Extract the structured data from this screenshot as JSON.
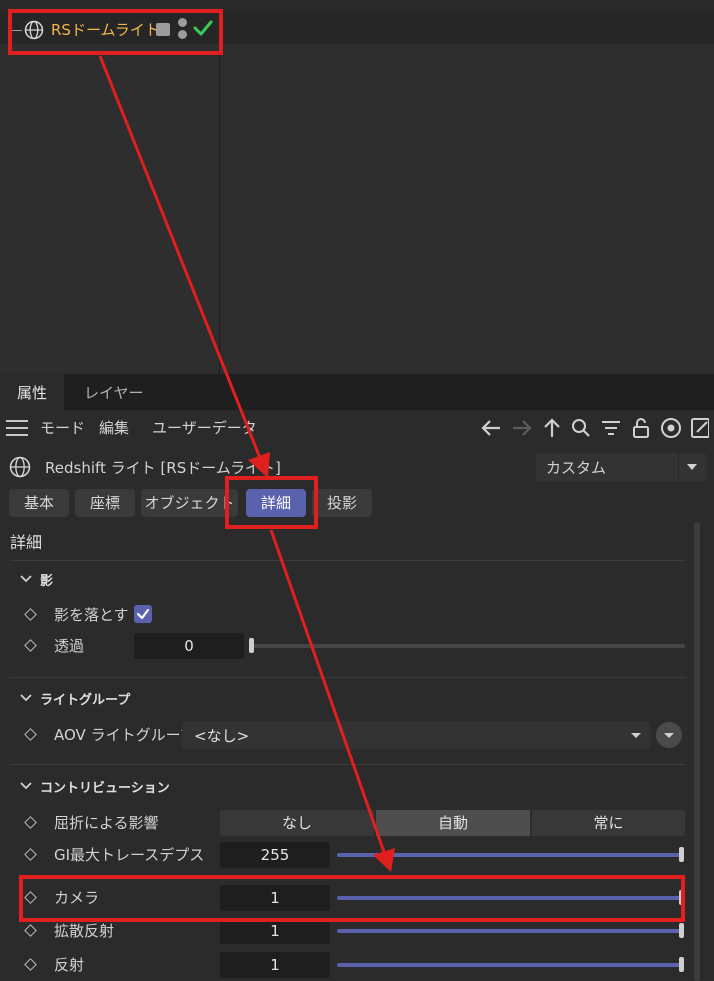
{
  "object_manager": {
    "object_name": "RSドームライト"
  },
  "attribute_manager": {
    "tabs": [
      {
        "label": "属性"
      },
      {
        "label": "レイヤー"
      }
    ],
    "menu": {
      "mode": "モード",
      "edit": "編集",
      "user_data": "ユーザーデータ"
    },
    "title": "Redshift ライト [RSドームライト]",
    "preset": "カスタム",
    "subtabs": [
      {
        "label": "基本"
      },
      {
        "label": "座標"
      },
      {
        "label": "オブジェクト"
      },
      {
        "label": "詳細"
      },
      {
        "label": "投影"
      }
    ],
    "section_title": "詳細",
    "groups": {
      "shadow": "影",
      "light_group": "ライトグループ",
      "contribution": "コントリビューション"
    },
    "params": {
      "cast_shadow": {
        "label": "影を落とす",
        "checked": true
      },
      "transparency": {
        "label": "透過",
        "value": "0",
        "fraction": 0
      },
      "aov_light_group": {
        "label": "AOV ライトグループ",
        "value": "<なし>"
      },
      "refraction_influence": {
        "label": "屈折による影響",
        "options": [
          "なし",
          "自動",
          "常に"
        ],
        "selected": "自動"
      },
      "gi_max_depth": {
        "label": "GI最大トレースデプス",
        "value": "255",
        "fraction": 1
      },
      "camera": {
        "label": "カメラ",
        "value": "1",
        "fraction": 1
      },
      "diffuse": {
        "label": "拡散反射",
        "value": "1",
        "fraction": 1
      },
      "reflection": {
        "label": "反射",
        "value": "1",
        "fraction": 1
      }
    }
  },
  "colors": {
    "accent": "#5b62ad",
    "object_name": "#f0b84a",
    "annotation": "#e01f1f",
    "check_green": "#3ec95a"
  }
}
